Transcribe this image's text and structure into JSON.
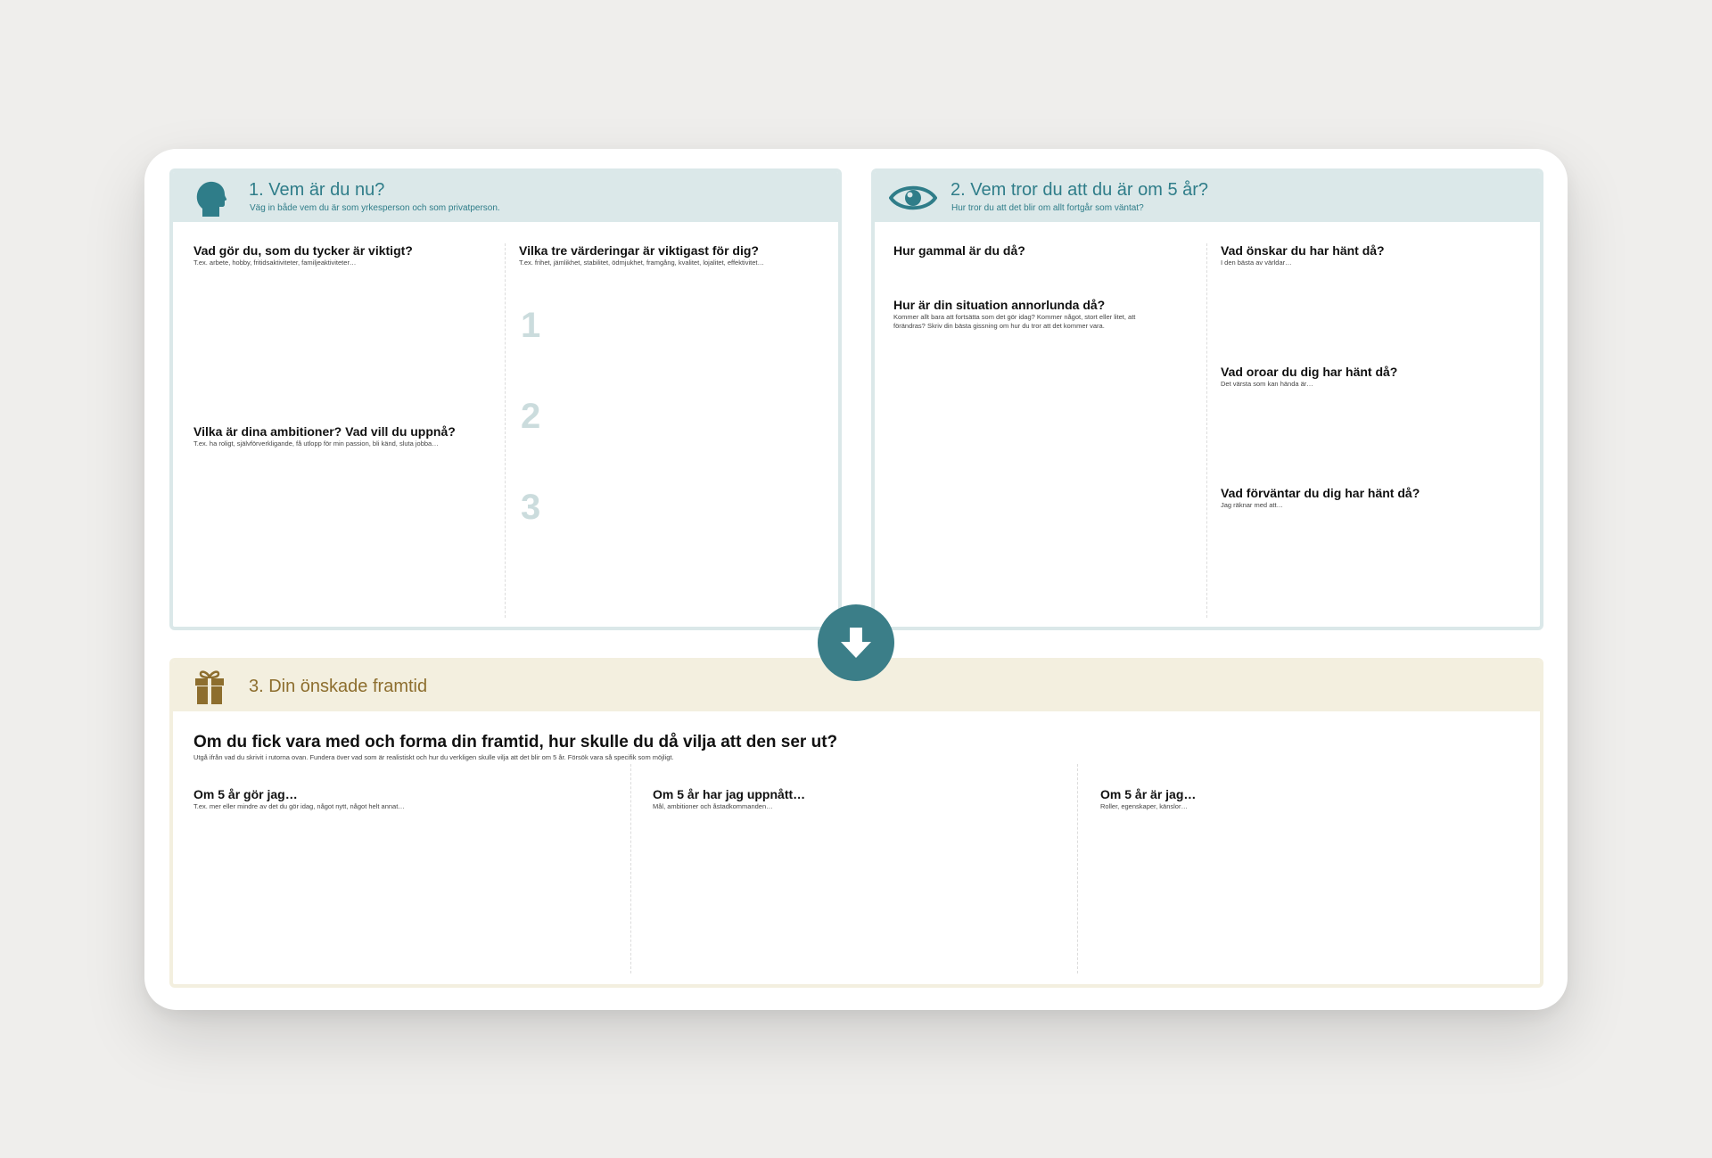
{
  "section1": {
    "title": "1. Vem är du nu?",
    "subtitle": "Väg in både vem du är som yrkesperson och som privatperson.",
    "icon": "head-silhouette-icon",
    "q1": {
      "label": "Vad gör du, som du tycker är viktigt?",
      "hint": "T.ex. arbete, hobby, fritidsaktiviteter, familjeaktiviteter…"
    },
    "q2": {
      "label": "Vilka är dina ambitioner? Vad vill du uppnå?",
      "hint": "T.ex. ha roligt, självförverkligande, få utlopp för min passion, bli känd, sluta jobba…"
    },
    "q3": {
      "label": "Vilka tre värderingar är viktigast för dig?",
      "hint": "T.ex. frihet, jämlikhet, stabilitet, ödmjukhet, framgång, kvalitet, lojalitet, effektivitet…"
    },
    "numbers": [
      "1",
      "2",
      "3"
    ]
  },
  "section2": {
    "title": "2. Vem tror du att du är om 5 år?",
    "subtitle": "Hur tror du att det blir om allt fortgår som väntat?",
    "icon": "eye-icon",
    "q1": {
      "label": "Hur gammal är du då?"
    },
    "q2": {
      "label": "Hur är din situation annorlunda då?",
      "hint": "Kommer allt bara att fortsätta som det gör idag? Kommer något, stort eller litet, att förändras? Skriv din bästa gissning om hur du tror att det kommer vara."
    },
    "q3": {
      "label": "Vad önskar du har hänt då?",
      "hint": "I den bästa av världar…"
    },
    "q4": {
      "label": "Vad oroar du dig har hänt då?",
      "hint": "Det värsta som kan hända är…"
    },
    "q5": {
      "label": "Vad förväntar du dig har hänt då?",
      "hint": "Jag räknar med att…"
    }
  },
  "section3": {
    "title": "3. Din önskade framtid",
    "icon": "gift-icon",
    "question": "Om du fick vara med och forma din framtid, hur skulle du då vilja att den ser ut?",
    "question_hint": "Utgå ifrån vad du skrivit i rutorna ovan. Fundera över vad som är realistiskt och hur du verkligen skulle vilja att det blir om 5 år. Försök vara så specifik som möjligt.",
    "col1": {
      "label": "Om 5 år gör jag…",
      "hint": "T.ex. mer eller mindre av det du gör idag, något nytt, något helt annat…"
    },
    "col2": {
      "label": "Om 5 år har jag uppnått…",
      "hint": "Mål, ambitioner och åstadkommanden…"
    },
    "col3": {
      "label": "Om 5 år är jag…",
      "hint": "Roller, egenskaper, känslor…"
    }
  },
  "arrow": {
    "icon": "arrow-down-icon"
  },
  "colors": {
    "teal": "#2f7d89",
    "teal_header": "#dbe8e9",
    "gold": "#8d6e2e",
    "gold_header": "#f3efdf",
    "arrow_bg": "#3b7e88",
    "background": "#efeeec"
  }
}
